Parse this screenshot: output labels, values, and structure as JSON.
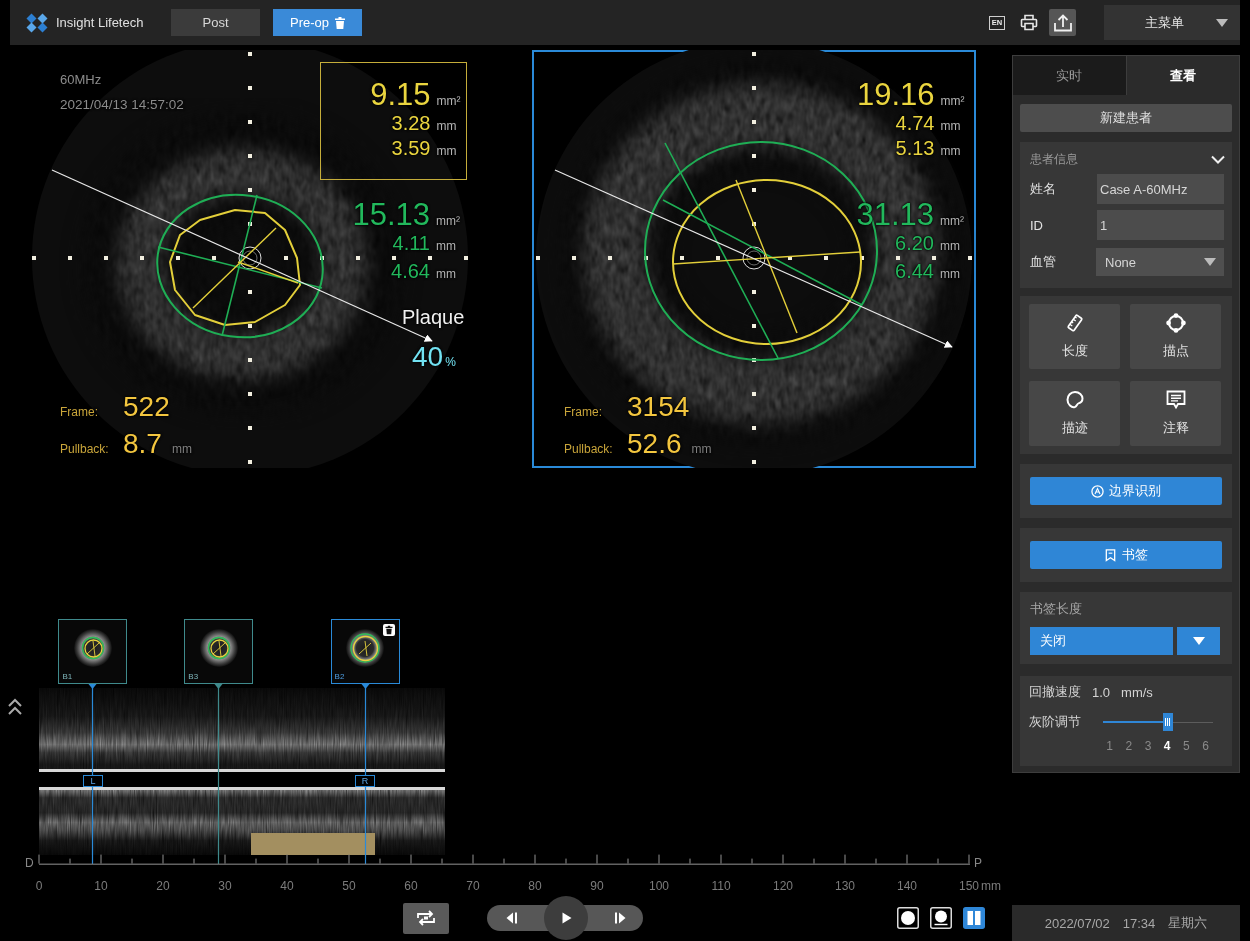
{
  "top_bar": {
    "brand": "Insight Lifetech",
    "tabs": [
      {
        "label": "Post",
        "selected": false
      },
      {
        "label": "Pre-op",
        "selected": true
      }
    ],
    "language": "EN",
    "menu": "主菜单"
  },
  "views": [
    {
      "selected": false,
      "frequency": "60MHz",
      "timestamp": "2021/04/13 14:57:02",
      "lumen": {
        "highlighted": true,
        "rows": [
          {
            "value": "9.15",
            "unit": "mm²"
          },
          {
            "value": "3.28",
            "unit": "mm"
          },
          {
            "value": "3.59",
            "unit": "mm"
          }
        ]
      },
      "vessel": {
        "rows": [
          {
            "value": "15.13",
            "unit": "mm²"
          },
          {
            "value": "4.11",
            "unit": "mm"
          },
          {
            "value": "4.64",
            "unit": "mm"
          }
        ]
      },
      "plaque": {
        "label": "Plaque",
        "value": "40",
        "unit": "%"
      },
      "frame": {
        "label": "Frame:",
        "value": "522"
      },
      "pullback": {
        "label": "Pullback:",
        "value": "8.7",
        "unit": "mm"
      }
    },
    {
      "selected": true,
      "lumen": {
        "highlighted": false,
        "rows": [
          {
            "value": "19.16",
            "unit": "mm²"
          },
          {
            "value": "4.74",
            "unit": "mm"
          },
          {
            "value": "5.13",
            "unit": "mm"
          }
        ]
      },
      "vessel": {
        "rows": [
          {
            "value": "31.13",
            "unit": "mm²"
          },
          {
            "value": "6.20",
            "unit": "mm"
          },
          {
            "value": "6.44",
            "unit": "mm"
          }
        ]
      },
      "frame": {
        "label": "Frame:",
        "value": "3154"
      },
      "pullback": {
        "label": "Pullback:",
        "value": "52.6",
        "unit": "mm"
      }
    }
  ],
  "timeline": {
    "bookmarks": [
      {
        "label": "B1",
        "selected": false,
        "cursor": "L"
      },
      {
        "label": "B3",
        "selected": false
      },
      {
        "label": "B2",
        "selected": true,
        "cursor": "R"
      }
    ],
    "ruler": {
      "start": "D",
      "end": "P",
      "labels": [
        "0",
        "10",
        "20",
        "30",
        "40",
        "50",
        "60",
        "70",
        "80",
        "90",
        "100",
        "110",
        "120",
        "130",
        "140",
        "150"
      ],
      "unit": "mm"
    }
  },
  "view_modes": [
    {
      "kind": "single",
      "selected": false
    },
    {
      "kind": "overlay",
      "selected": false
    },
    {
      "kind": "dual",
      "selected": true
    }
  ],
  "side_panel": {
    "tabs": [
      {
        "label": "实时",
        "selected": false
      },
      {
        "label": "查看",
        "selected": true
      }
    ],
    "new_patient": "新建患者",
    "patient_info": {
      "title": "患者信息",
      "expanded": true,
      "fields": [
        {
          "kind": "text",
          "label": "姓名",
          "value": "Case A-60MHz"
        },
        {
          "kind": "text",
          "label": "ID",
          "value": "1"
        },
        {
          "kind": "select",
          "label": "血管",
          "value": "None"
        }
      ]
    },
    "tools": [
      {
        "kind": "ruler",
        "label": "长度"
      },
      {
        "kind": "points",
        "label": "描点"
      },
      {
        "kind": "trace",
        "label": "描迹"
      },
      {
        "kind": "note",
        "label": "注释"
      }
    ],
    "border_detect": "边界识别",
    "bookmark": "书签",
    "bookmark_length": {
      "label": "书签长度",
      "value": "关闭"
    },
    "pullback_speed": {
      "label": "回撤速度",
      "value": "1.0",
      "unit": "mm/s"
    },
    "grayscale": {
      "label": "灰阶调节",
      "level": 0.6,
      "steps": [
        {
          "label": "1",
          "selected": false
        },
        {
          "label": "2",
          "selected": false
        },
        {
          "label": "3",
          "selected": false
        },
        {
          "label": "4",
          "selected": true
        },
        {
          "label": "5",
          "selected": false
        },
        {
          "label": "6",
          "selected": false
        }
      ]
    }
  },
  "status_bar": {
    "date": "2022/07/02",
    "time": "17:34",
    "weekday": "星期六"
  }
}
